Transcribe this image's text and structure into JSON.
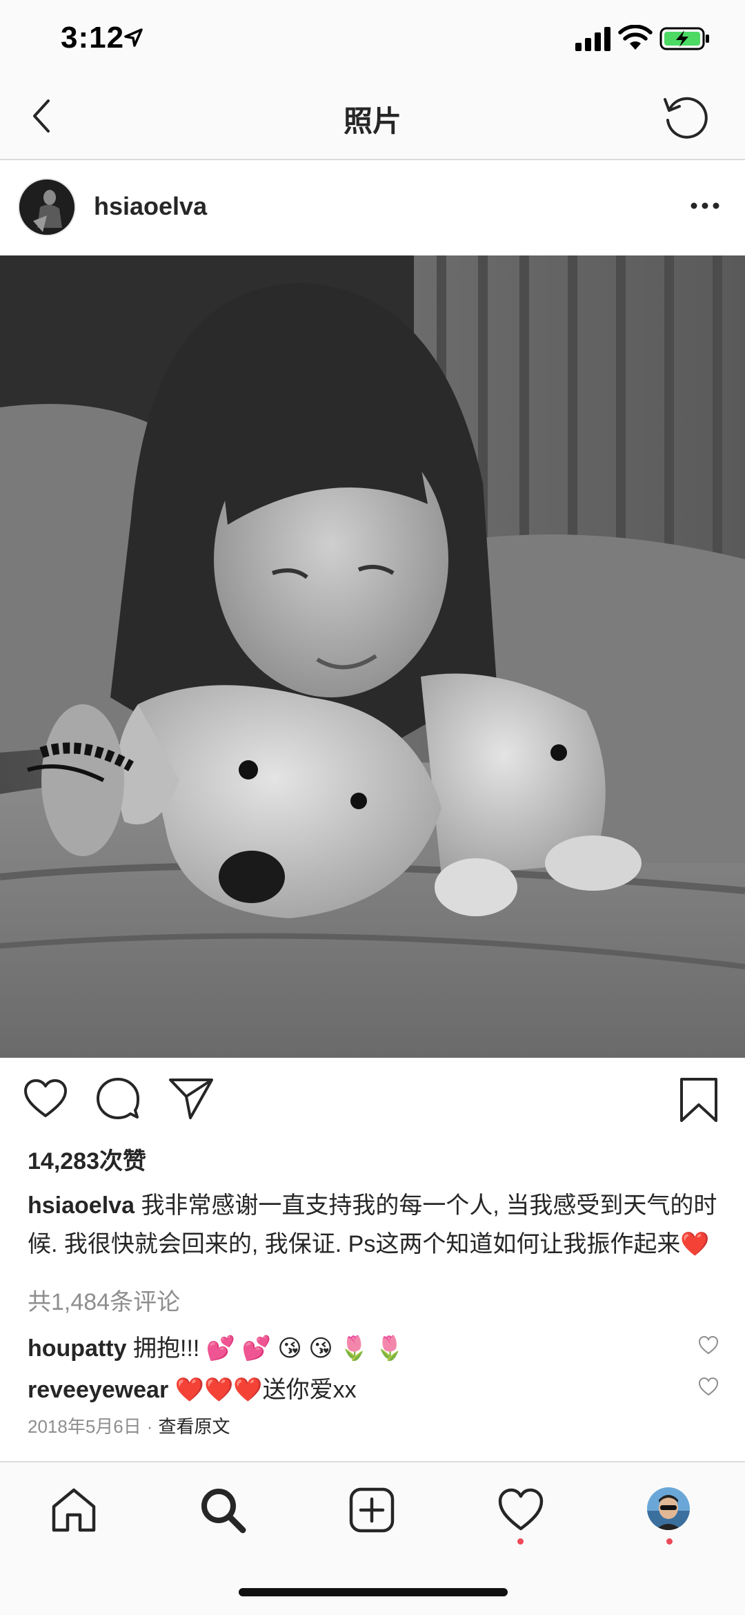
{
  "status_bar": {
    "time": "3:12"
  },
  "header": {
    "title": "照片"
  },
  "post": {
    "username": "hsiaoelva",
    "likes": "14,283次赞",
    "caption": {
      "username": "hsiaoelva",
      "text": "我非常感谢一直支持我的每一个人, 当我感受到天气的时候. 我很快就会回来的, 我保证. Ps这两个知道如何让我振作起来",
      "emoji": "❤️"
    },
    "view_all_comments": "共1,484条评论",
    "comments": [
      {
        "username": "houpatty",
        "text": "拥抱!!! 💕 💕 😘 😘 🌷 🌷"
      },
      {
        "username": "reveeyewear",
        "text": "❤️❤️❤️送你爱xx"
      }
    ],
    "date": "2018年5月6日",
    "separator": "·",
    "view_original": "查看原文"
  },
  "colors": {
    "text": "#262626",
    "secondary": "#8e8e8e",
    "notification_dot": "#ed4956",
    "divider": "#dbdbdb"
  },
  "icons": {
    "back": "chevron-left-icon",
    "refresh": "refresh-icon",
    "more": "more-horizontal-icon",
    "like": "heart-icon",
    "comment": "comment-icon",
    "share": "send-icon",
    "bookmark": "bookmark-icon",
    "tabs": [
      "home-icon",
      "search-icon",
      "add-icon",
      "heart-icon",
      "profile-avatar"
    ]
  }
}
